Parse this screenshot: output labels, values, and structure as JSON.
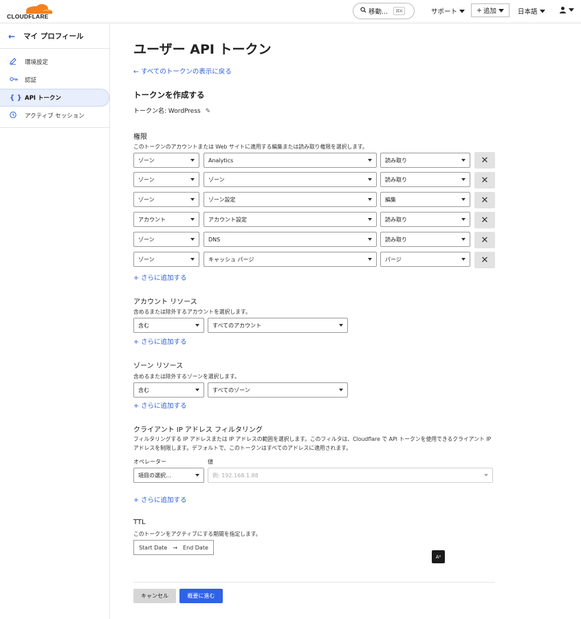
{
  "brand": {
    "logo_text": "CLOUDFLARE",
    "accent": "#f38020",
    "link": "#2c5ed8",
    "primary": "#2f63e6"
  },
  "topbar": {
    "search_label": "移動...",
    "search_shortcut": "⌘K",
    "support_label": "サポート",
    "add_label": "追加",
    "language_label": "日本語"
  },
  "sidebar": {
    "title": "マイ プロフィール",
    "items": [
      {
        "label": "環境設定",
        "icon": "pencil-icon"
      },
      {
        "label": "認証",
        "icon": "key-icon"
      },
      {
        "label": "API トークン",
        "icon": "braces-icon",
        "active": true
      },
      {
        "label": "アクティブ セッション",
        "icon": "clock-icon"
      }
    ]
  },
  "main": {
    "title": "ユーザー API トークン",
    "back_link": "← すべてのトークンの表示に戻る",
    "create_heading": "トークンを作成する",
    "token_name_label": "トークン名: WordPress",
    "permissions": {
      "heading": "権限",
      "description": "このトークンのアカウントまたは Web サイトに適用する編集または読み取り権限を選択します。",
      "rows": [
        {
          "scope": "ゾーン",
          "resource": "Analytics",
          "access": "読み取り"
        },
        {
          "scope": "ゾーン",
          "resource": "ゾーン",
          "access": "読み取り"
        },
        {
          "scope": "ゾーン",
          "resource": "ゾーン設定",
          "access": "編集"
        },
        {
          "scope": "アカウント",
          "resource": "アカウント設定",
          "access": "読み取り"
        },
        {
          "scope": "ゾーン",
          "resource": "DNS",
          "access": "読み取り"
        },
        {
          "scope": "ゾーン",
          "resource": "キャッシュ パージ",
          "access": "パージ"
        }
      ],
      "add_more": "+ さらに追加する"
    },
    "account_resources": {
      "heading": "アカウント リソース",
      "description": "含めるまたは除外するアカウントを選択します。",
      "include": "含む",
      "target": "すべてのアカウント",
      "add_more": "+ さらに追加する"
    },
    "zone_resources": {
      "heading": "ゾーン リソース",
      "description": "含めるまたは除外するゾーンを選択します。",
      "include": "含む",
      "target": "すべてのゾーン",
      "add_more": "+ さらに追加する"
    },
    "ip_filter": {
      "heading": "クライアント IP アドレス フィルタリング",
      "description": "フィルタリングする IP アドレスまたは IP アドレスの範囲を選択します。このフィルタは、Cloudflare で API トークンを使用できるクライアント IP アドレスを制限します。デフォルトで、このトークンはすべてのアドレスに適用されます。",
      "operator_label": "オペレーター",
      "value_label": "値",
      "operator_placeholder": "項目の選択...",
      "value_placeholder": "例: 192.168.1.88",
      "add_more": "+ さらに追加する"
    },
    "ttl": {
      "heading": "TTL",
      "description": "このトークンをアクティブにする期間を指定します。",
      "start": "Start Date",
      "arrow": "→",
      "end": "End Date"
    },
    "actions": {
      "cancel": "キャンセル",
      "next": "概要に進む"
    }
  }
}
